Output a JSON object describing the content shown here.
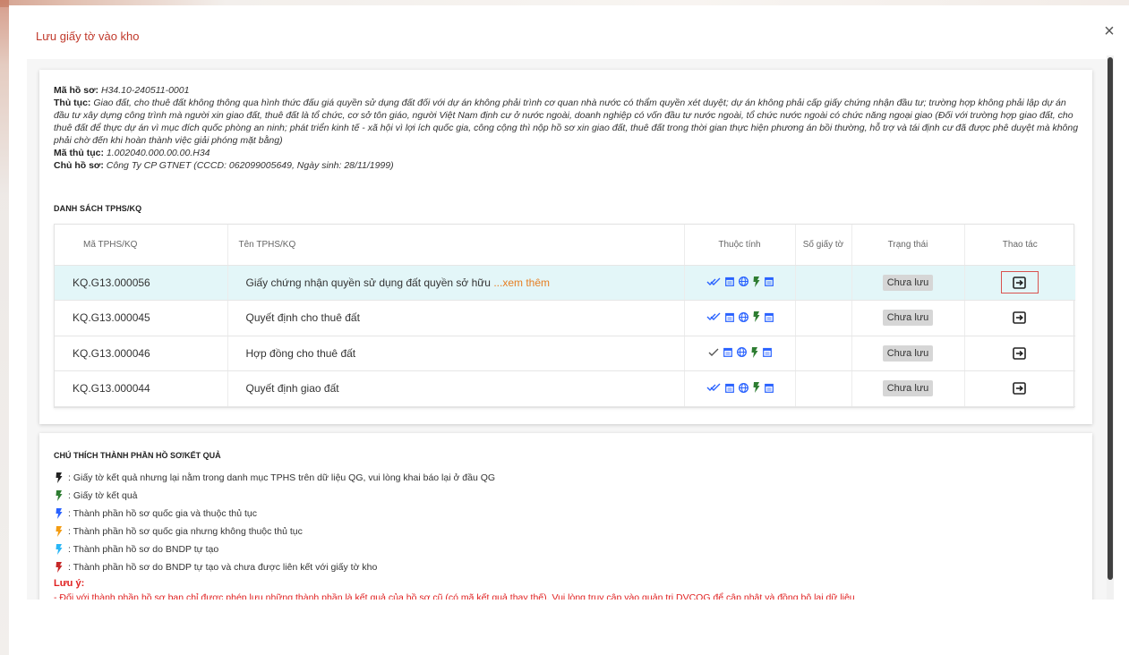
{
  "dialog": {
    "title": "Lưu giấy tờ vào kho",
    "close_icon": "×"
  },
  "info": {
    "ma_ho_so_label": "Mã hồ sơ:",
    "ma_ho_so_value": "H34.10-240511-0001",
    "thu_tuc_label": "Thủ tục:",
    "thu_tuc_value": "Giao đất, cho thuê đất không thông qua hình thức đấu giá quyền sử dụng đất đối với dự án không phải trình cơ quan nhà nước có thẩm quyền xét duyệt; dự án không phải cấp giấy chứng nhận đầu tư; trường hợp không phải lập dự án đầu tư xây dựng công trình mà người xin giao đất, thuê đất là tổ chức, cơ sở tôn giáo, người Việt Nam định cư ở nước ngoài, doanh nghiệp có vốn đầu tư nước ngoài, tổ chức nước ngoài có chức năng ngoại giao (Đối với trường hợp giao đất, cho thuê đất để thực dự án vì mục đích quốc phòng an ninh; phát triển kinh tế - xã hội vì lợi ích quốc gia, công cộng thì nộp hồ sơ xin giao đất, thuê đất trong thời gian thực hiện phương án bồi thường, hỗ trợ và tái định cư đã được phê duyệt mà không phải chờ đến khi hoàn thành việc giải phóng mặt bằng)",
    "ma_thu_tuc_label": "Mã thủ tục:",
    "ma_thu_tuc_value": "1.002040.000.00.00.H34",
    "chu_ho_so_label": "Chủ hồ sơ:",
    "chu_ho_so_value": "Công Ty CP GTNET (CCCD:  062099005649, Ngày sinh:  28/11/1999)"
  },
  "list": {
    "title": "DANH SÁCH TPHS/KQ",
    "columns": [
      "Mã TPHS/KQ",
      "Tên TPHS/KQ",
      "Thuộc tính",
      "Số giấy tờ",
      "Trạng thái",
      "Thao tác"
    ],
    "more_link": "...xem thêm",
    "rows": [
      {
        "code": "KQ.G13.000056",
        "name": "Giấy chứng nhận quyền sử dụng đất quyền sở hữu ",
        "status": "Chưa lưu",
        "check_icon": "double-check-icon"
      },
      {
        "code": "KQ.G13.000045",
        "name": "Quyết định cho thuê đất",
        "status": "Chưa lưu",
        "check_icon": "double-check-icon"
      },
      {
        "code": "KQ.G13.000046",
        "name": "Hợp đồng cho thuê đất",
        "status": "Chưa lưu",
        "check_icon": "single-check-icon"
      },
      {
        "code": "KQ.G13.000044",
        "name": "Quyết định giao đất",
        "status": "Chưa lưu",
        "check_icon": "double-check-icon"
      }
    ]
  },
  "legend": {
    "title": "CHÚ THÍCH THÀNH PHẦN HỒ SƠ/KẾT QUẢ",
    "items": [
      {
        "color": "#222222",
        "text": ": Giấy tờ kết quả nhưng lại nằm trong danh mục TPHS trên dữ liệu QG, vui lòng khai báo lại ở đầu QG"
      },
      {
        "color": "#2e7d32",
        "text": ": Giấy tờ kết quả"
      },
      {
        "color": "#2962ff",
        "text": ": Thành phần hồ sơ quốc gia và thuộc thủ tục"
      },
      {
        "color": "#f39c12",
        "text": ": Thành phần hồ sơ quốc gia nhưng không thuộc thủ tục"
      },
      {
        "color": "#29b6f6",
        "text": ": Thành phần hồ sơ do BNDP tự tạo"
      },
      {
        "color": "#c62828",
        "text": ": Thành phần hồ sơ do BNDP tự tạo và chưa được liên kết với giấy tờ kho"
      }
    ],
    "note_title": "Lưu ý:",
    "note_text": "- Đối với thành phần hồ sơ bạn chỉ được phép lưu những thành phần là kết quả của hồ sơ cũ (có mã kết quả thay thế). Vui lòng truy cập vào quản trị DVCQG để cập nhật và đồng bộ lại dữ liệu"
  },
  "colors": {
    "accent_red": "#c0392b",
    "icon_blue": "#2962ff",
    "icon_green": "#2e7d32",
    "row_highlight": "#e3f6f8"
  }
}
